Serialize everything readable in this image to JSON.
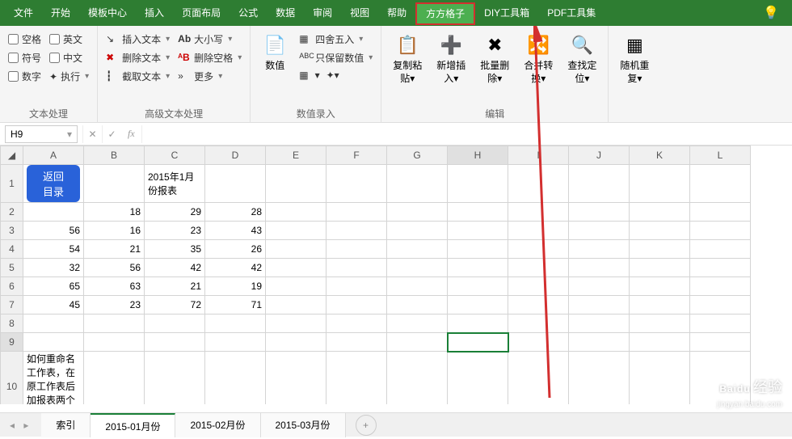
{
  "tabs": {
    "items": [
      "文件",
      "开始",
      "模板中心",
      "插入",
      "页面布局",
      "公式",
      "数据",
      "审阅",
      "视图",
      "帮助",
      "方方格子",
      "DIY工具箱",
      "PDF工具集"
    ],
    "active": "方方格子"
  },
  "ribbon": {
    "g1": {
      "label": "文本处理",
      "c1": [
        "空格",
        "符号",
        "数字"
      ],
      "c2": [
        "英文",
        "中文",
        "执行"
      ]
    },
    "g2": {
      "label": "高级文本处理",
      "c1": [
        "插入文本",
        "删除文本",
        "截取文本"
      ],
      "c2": [
        "大小写",
        "删除空格",
        "更多"
      ]
    },
    "g3": {
      "label": "数值录入",
      "big": "数值",
      "c1": [
        "四舍五入",
        "只保留数值"
      ]
    },
    "g4": {
      "label": "编辑",
      "items": [
        "复制粘\n贴",
        "新增插\n入",
        "批量删\n除",
        "合并转\n换",
        "查找定\n位"
      ]
    },
    "g5": {
      "items": [
        "随机重\n复"
      ]
    }
  },
  "namebox": "H9",
  "cells": {
    "title": "2015年1月份报表",
    "btn": "返回目录",
    "rows": [
      [
        "",
        "18",
        "29",
        "28"
      ],
      [
        "56",
        "16",
        "23",
        "43"
      ],
      [
        "54",
        "21",
        "35",
        "26"
      ],
      [
        "32",
        "56",
        "42",
        "42"
      ],
      [
        "65",
        "63",
        "21",
        "19"
      ],
      [
        "45",
        "23",
        "72",
        "71"
      ]
    ],
    "note": "如何重命名工作表，在原工作表后加报表两个字"
  },
  "cols": [
    "A",
    "B",
    "C",
    "D",
    "E",
    "F",
    "G",
    "H",
    "I",
    "J",
    "K",
    "L"
  ],
  "sheets": {
    "items": [
      "索引",
      "2015-01月份",
      "2015-02月份",
      "2015-03月份"
    ],
    "active": "2015-01月份"
  },
  "watermark": {
    "brand": "Baidu",
    "sub": "经验",
    "url": "jingyan.baidu.com"
  }
}
